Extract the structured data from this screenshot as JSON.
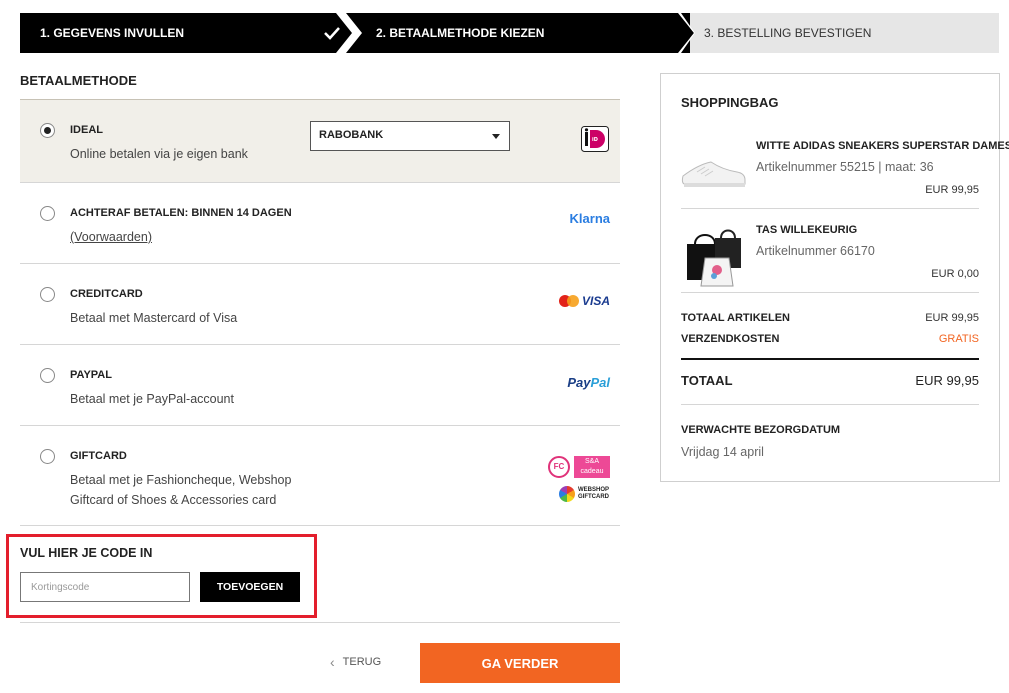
{
  "steps": [
    {
      "label": "1. GEGEVENS INVULLEN",
      "state": "done"
    },
    {
      "label": "2. BETAALMETHODE KIEZEN",
      "state": "active"
    },
    {
      "label": "3. BESTELLING BEVESTIGEN",
      "state": "upcoming"
    }
  ],
  "payment": {
    "section_title": "BETAALMETHODE",
    "methods": [
      {
        "title": "IDEAL",
        "desc": "Online betalen via je eigen bank",
        "selected": true,
        "bank_select_value": "RABOBANK",
        "logo": "ideal-icon"
      },
      {
        "title": "ACHTERAF BETALEN: BINNEN 14 DAGEN",
        "link": "(Voorwaarden)",
        "selected": false,
        "logo_text": "Klarna"
      },
      {
        "title": "CREDITCARD",
        "desc": "Betaal met Mastercard of Visa",
        "selected": false,
        "logo_text": "VISA"
      },
      {
        "title": "PAYPAL",
        "desc": "Betaal met je PayPal-account",
        "selected": false,
        "logo_text_a": "Pay",
        "logo_text_b": "Pal"
      },
      {
        "title": "GIFTCARD",
        "desc_line1": "Betaal met je Fashioncheque, Webshop",
        "desc_line2": "Giftcard of Shoes & Accessories card",
        "selected": false,
        "logo_fc": "FC",
        "logo_sa_line1": "S&A",
        "logo_sa_line2": "cadeau",
        "logo_wg_line1": "WEBSHOP",
        "logo_wg_line2": "GIFTCARD"
      }
    ]
  },
  "coupon": {
    "title": "VUL HIER JE CODE IN",
    "placeholder": "Kortingscode",
    "button": "TOEVOEGEN"
  },
  "nav": {
    "back": "TERUG",
    "next": "GA VERDER"
  },
  "bag": {
    "title": "SHOPPINGBAG",
    "items": [
      {
        "name": "WITTE ADIDAS SNEAKERS SUPERSTAR DAMES",
        "meta": "Artikelnummer 55215 | maat: 36",
        "price": "EUR 99,95"
      },
      {
        "name": "TAS WILLEKEURIG",
        "meta": "Artikelnummer 66170",
        "price": "EUR 0,00"
      }
    ],
    "total_items_label": "TOTAAL ARTIKELEN",
    "total_items_value": "EUR 99,95",
    "shipping_label": "VERZENDKOSTEN",
    "shipping_value": "GRATIS",
    "total_label": "TOTAAL",
    "total_value": "EUR 99,95",
    "delivery_label": "VERWACHTE BEZORGDATUM",
    "delivery_value": "Vrijdag 14 april"
  },
  "colors": {
    "accent": "#f26522",
    "highlight_border": "#e31e2c",
    "selected_row_bg": "#f1efe9"
  }
}
